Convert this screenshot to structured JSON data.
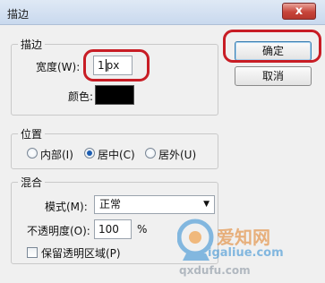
{
  "window": {
    "title": "描边",
    "close_label": "x"
  },
  "stroke_group": {
    "legend": "描边",
    "width_label": "宽度(W):",
    "width_value": "1",
    "width_unit": "px",
    "color_label": "颜色:",
    "color_value": "#000000"
  },
  "position_group": {
    "legend": "位置",
    "options": [
      {
        "label": "内部(I)",
        "selected": false
      },
      {
        "label": "居中(C)",
        "selected": true
      },
      {
        "label": "居外(U)",
        "selected": false
      }
    ]
  },
  "blend_group": {
    "legend": "混合",
    "mode_label": "模式(M):",
    "mode_value": "正常",
    "opacity_label": "不透明度(O):",
    "opacity_value": "100",
    "opacity_unit": "%",
    "preserve_label": "保留透明区域(P)",
    "preserve_checked": false
  },
  "buttons": {
    "ok": "确定",
    "cancel": "取消"
  },
  "watermark": {
    "brand": "爱知网",
    "site": "igaliue.com",
    "site2": "qxdufu.com"
  },
  "colors": {
    "highlight": "#c81d25",
    "radio_dot": "#1c5db2",
    "close_button": "#c7453a"
  }
}
